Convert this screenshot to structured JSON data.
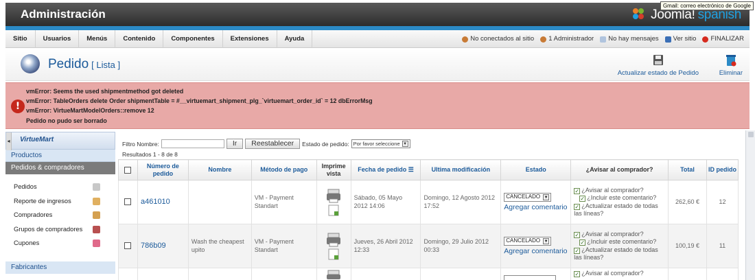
{
  "app": {
    "title": "Administración",
    "brand_name": "Joomla!",
    "brand_locale": "spanish",
    "tooltip": "Gmail: correo electrónico de Google"
  },
  "menu": {
    "items": [
      "Sitio",
      "Usuarios",
      "Menús",
      "Contenido",
      "Componentes",
      "Extensiones",
      "Ayuda"
    ]
  },
  "status": {
    "offline": "No conectados al sitio",
    "admins": "1 Administrador",
    "messages": "No hay mensajes",
    "view_site": "Ver sitio",
    "logout": "FINALIZAR"
  },
  "page": {
    "title": "Pedido",
    "subtitle": "[ Lista ]"
  },
  "toolbar": {
    "update_label": "Actualizar estado de Pedido",
    "delete_label": "Eliminar"
  },
  "errors": [
    "vmError: Seems the used shipmentmethod got deleted",
    "vmError: TableOrders delete Order shipmentTable = #__virtuemart_shipment_plg_`virtuemart_order_id` = 12 dbErrorMsg",
    "vmError: VirtueMartModelOrders::remove 12",
    "Pedido no pudo ser borrado"
  ],
  "sidebar": {
    "logo": "VirtueMart",
    "sections": {
      "products": "Productos",
      "orders": "Pedidos & compradores",
      "manufacturers": "Fabricantes"
    },
    "items": [
      {
        "label": "Pedidos",
        "icon": "orders-icon",
        "color": "#c8c8c8"
      },
      {
        "label": "Reporte de ingresos",
        "icon": "report-icon",
        "color": "#e0b060"
      },
      {
        "label": "Compradores",
        "icon": "customers-icon",
        "color": "#d4a050"
      },
      {
        "label": "Grupos de compradores",
        "icon": "customer-groups-icon",
        "color": "#b85050"
      },
      {
        "label": "Cupones",
        "icon": "coupon-icon",
        "color": "#e06a8a"
      }
    ]
  },
  "filter": {
    "name_label": "Filtro Nombre:",
    "name_value": "",
    "go_button": "Ir",
    "reset_button": "Reestablecer",
    "status_label": "Estado de pedido:",
    "status_value": "Por favor seleccione"
  },
  "results": "Resultados 1 - 8 de 8",
  "table": {
    "headers": {
      "order_number": "Número de pedido",
      "name": "Nombre",
      "payment": "Método de pago",
      "print": "Imprime vista",
      "order_date": "Fecha de pedido",
      "modified": "Ultima modificación",
      "status": "Estado",
      "notify": "¿Avisar al comprador?",
      "total": "Total",
      "id": "ID pedido"
    },
    "rows": [
      {
        "order_number": "a461010",
        "name": "",
        "payment": "VM - Payment Standart",
        "order_date": "Sábado, 05 Mayo 2012 14:06",
        "modified": "Domingo, 12 Agosto 2012 17:52",
        "status": "CANCELADO",
        "add_comment": "Agregar comentario",
        "notify": "¿Avisar al comprador?",
        "include_comment": "¿Incluir este comentario?",
        "update_lines": "¿Actualizar estado de todas las líneas?",
        "total": "262,60 €",
        "id": "12"
      },
      {
        "order_number": "786b09",
        "name": "Wash the cheapest upito",
        "payment": "VM - Payment Standart",
        "order_date": "Jueves, 26 Abril 2012 12:33",
        "modified": "Domingo, 29 Julio 2012 00:33",
        "status": "CANCELADO",
        "add_comment": "Agregar comentario",
        "notify": "¿Avisar al comprador?",
        "include_comment": "¿Incluir este comentario?",
        "update_lines": "¿Actualizar estado de todas las líneas?",
        "total": "100,19 €",
        "id": "11"
      },
      {
        "notify": "¿Avisar al comprador?"
      }
    ]
  }
}
